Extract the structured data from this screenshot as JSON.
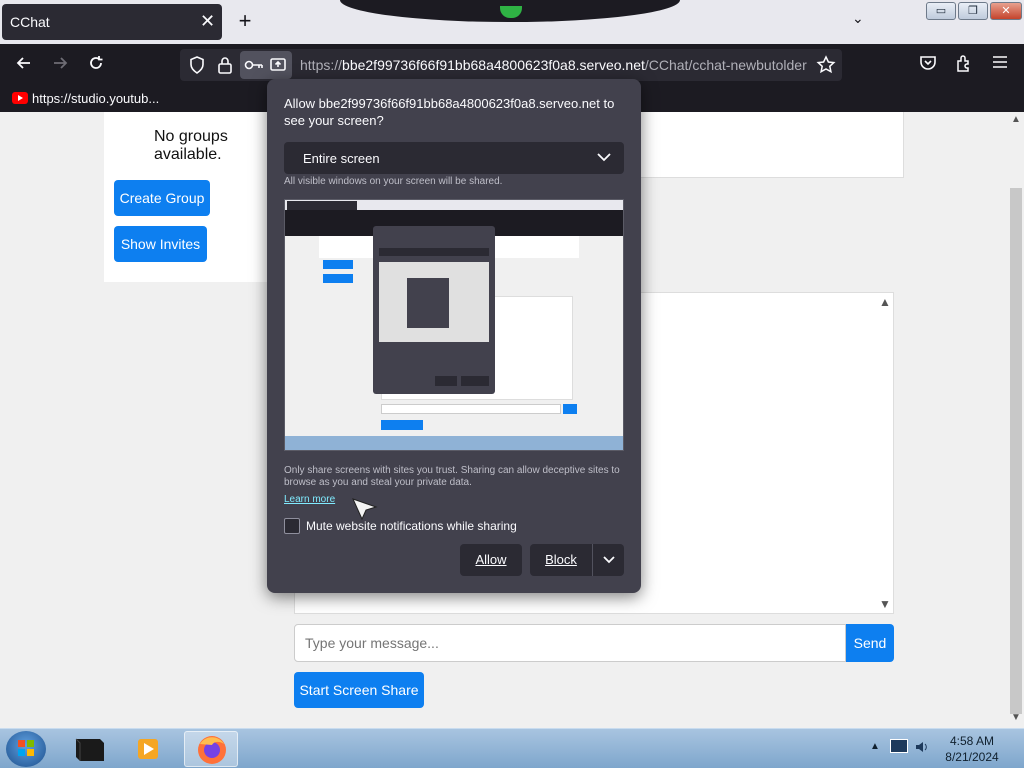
{
  "browser": {
    "tab_title": "CChat",
    "tab_close": "✕",
    "new_tab": "+",
    "tab_list": "⌄",
    "window_minimize": "▭",
    "window_restore": "❐",
    "window_close": "✕",
    "url_prefix": "https://",
    "url_host": "bbe2f99736f66f91bb68a4800623f0a8.serveo.net",
    "url_path": "/CChat/cchat-newbutolder",
    "bookmark_label": "https://studio.youtub..."
  },
  "page": {
    "no_groups_text": "No groups available.",
    "create_group_label": "Create Group",
    "show_invites_label": "Show Invites",
    "message_placeholder": "Type your message...",
    "send_label": "Send",
    "screen_share_label": "Start Screen Share"
  },
  "dialog": {
    "title": "Allow bbe2f99736f66f91bb68a4800623f0a8.serveo.net to see your screen?",
    "source_selected": "Entire screen",
    "source_hint": "All visible windows on your screen will be shared.",
    "warning": "Only share screens with sites you trust. Sharing can allow deceptive sites to browse as you and steal your private data.",
    "learn_more": "Learn more",
    "mute_label": "Mute website notifications while sharing",
    "allow_label": "Allow",
    "block_label": "Block"
  },
  "taskbar": {
    "time": "4:58 AM",
    "date": "8/21/2024"
  },
  "colors": {
    "accent": "#0d7ff0",
    "dialog_bg": "#42414d",
    "chrome_dark": "#1c1b22"
  }
}
